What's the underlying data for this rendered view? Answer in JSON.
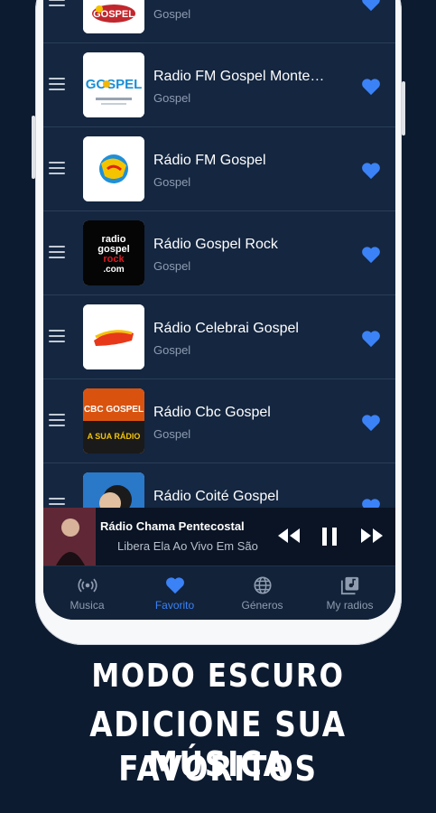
{
  "stations": [
    {
      "title": "",
      "genre": "Gospel",
      "logo": "gospel-radio-logo",
      "favorite": true
    },
    {
      "title": "Radio FM Gospel Monte…",
      "genre": "Gospel",
      "logo": "gospel-monte-logo",
      "favorite": true
    },
    {
      "title": "Rádio FM Gospel",
      "genre": "Gospel",
      "logo": "fm-gospel-logo",
      "favorite": true
    },
    {
      "title": "Rádio Gospel Rock",
      "genre": "Gospel",
      "logo": "radio-gospel-rock-logo",
      "favorite": true
    },
    {
      "title": "Rádio Celebrai Gospel",
      "genre": "Gospel",
      "logo": "celebrai-gospel-logo",
      "favorite": true
    },
    {
      "title": "Rádio Cbc Gospel",
      "genre": "Gospel",
      "logo": "cbc-gospel-logo",
      "favorite": true
    },
    {
      "title": "Rádio Coité Gospel",
      "genre": "",
      "logo": "coite-gospel-logo",
      "favorite": true
    }
  ],
  "player": {
    "title": "Rádio Chama Pentecostal",
    "subtitle": "Libera Ela Ao Vivo Em São"
  },
  "logos": {
    "gospel_top": "GOSPEL",
    "gospel_monte": "GOSPEL",
    "rock_line1": "radio",
    "rock_line2": "gospel",
    "rock_line3": "rock",
    "rock_line4": ".com",
    "cbc_line1": "CBC GOSPEL",
    "cbc_line2": "A SUA RÁDIO"
  },
  "nav": [
    {
      "label": "Musica",
      "icon": "broadcast-icon",
      "active": false
    },
    {
      "label": "Favorito",
      "icon": "heart-icon",
      "active": true
    },
    {
      "label": "Géneros",
      "icon": "globe-icon",
      "active": false
    },
    {
      "label": "My radios",
      "icon": "library-icon",
      "active": false
    }
  ],
  "caption": {
    "line1": "MODO ESCURO",
    "line2": "ADICIONE SUA MÚSICA",
    "line3": "FAVORITOS"
  },
  "colors": {
    "background": "#0d1b30",
    "accent": "#3b82f6",
    "screen": "#122238"
  }
}
